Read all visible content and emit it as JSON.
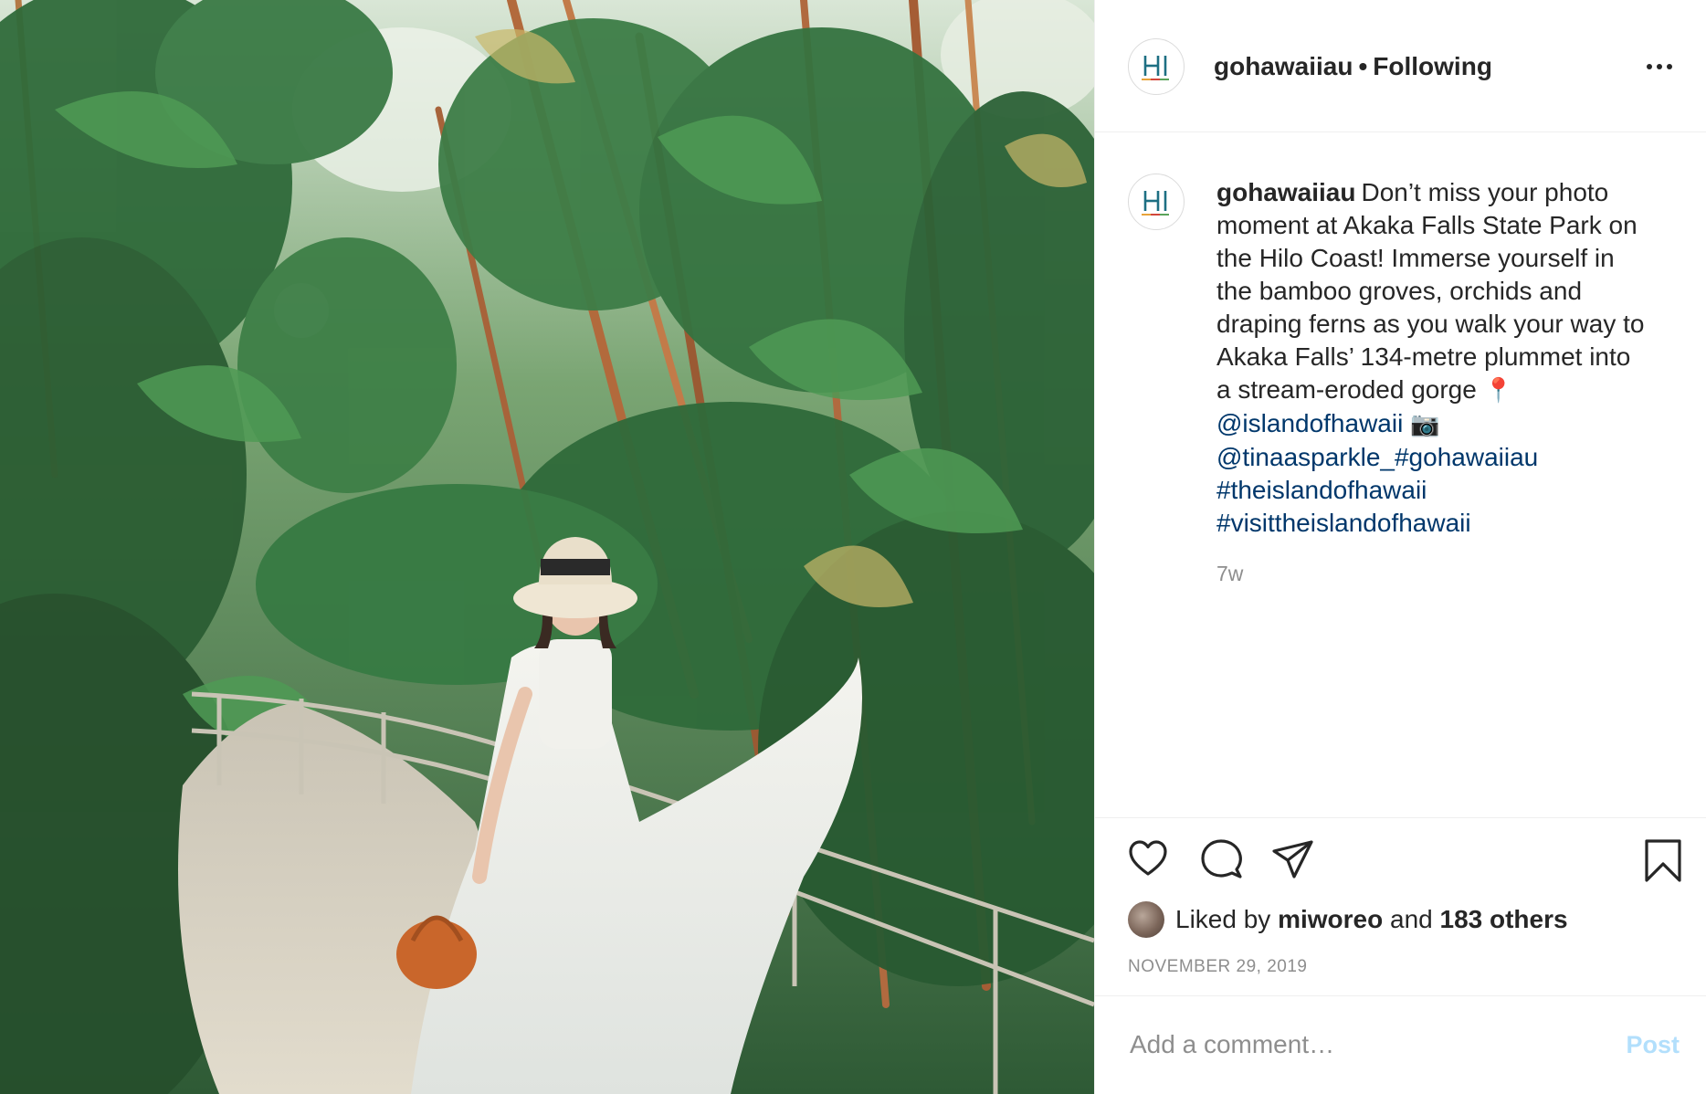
{
  "post": {
    "username": "gohawaiiau",
    "follow_state": "Following",
    "separator": "•",
    "photo_alt": "",
    "caption": {
      "text_lines": [
        "Don’t miss your photo",
        "moment at Akaka Falls State Park on",
        "the Hilo Coast! Immerse yourself in",
        "the bamboo groves, orchids and",
        "draping ferns as you walk your way to",
        "Akaka Falls’ 134-metre plummet into",
        "a stream-eroded gorge"
      ],
      "pin_emoji": "📍",
      "camera_emoji": "📷",
      "mention_1": "@islandofhawaii",
      "mention_2": "@tinaasparkle_",
      "hashtags": [
        "#gohawaiiau",
        "#theislandofhawaii",
        "#visittheislandofhawaii"
      ]
    },
    "time_ago": "7w",
    "likes": {
      "prefix": "Liked by",
      "liker": "miworeo",
      "conjunction": "and",
      "others": "183 others"
    },
    "date": "NOVEMBER 29, 2019"
  },
  "comment_box": {
    "placeholder": "Add a comment…",
    "post_label": "Post"
  },
  "icons": {
    "header_more": "more-options-icon",
    "like": "heart-icon",
    "comment": "comment-bubble-icon",
    "share": "paper-plane-icon",
    "save": "bookmark-icon",
    "avatar_logo": "hi-logo-icon"
  },
  "colors": {
    "link_blue": "#00376b",
    "post_button_disabled": "#b2dffc",
    "muted_text": "#8e8e8e",
    "logo_teal": "#1d6f83"
  }
}
